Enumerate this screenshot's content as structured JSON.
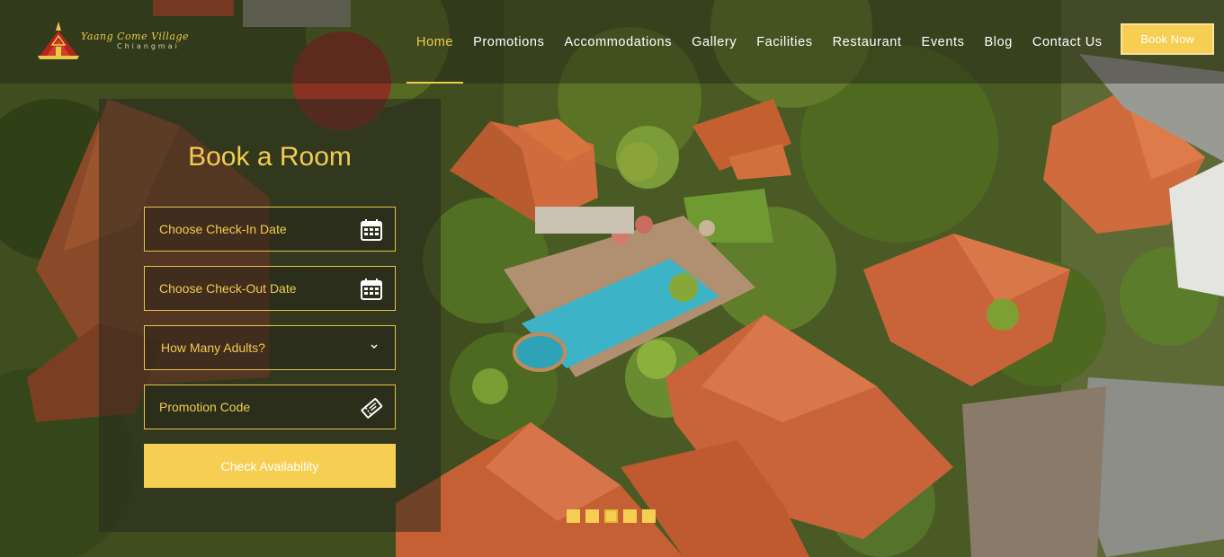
{
  "brand": {
    "name": "Yaang Come Village",
    "location": "Chiangmai"
  },
  "nav": {
    "items": [
      {
        "label": "Home",
        "active": true
      },
      {
        "label": "Promotions"
      },
      {
        "label": "Accommodations"
      },
      {
        "label": "Gallery"
      },
      {
        "label": "Facilities"
      },
      {
        "label": "Restaurant"
      },
      {
        "label": "Events"
      },
      {
        "label": "Blog"
      },
      {
        "label": "Contact Us"
      }
    ],
    "book_now": "Book Now"
  },
  "booking": {
    "title": "Book a Room",
    "checkin": {
      "value": "Choose Check-In Date",
      "icon": "calendar-icon"
    },
    "checkout": {
      "value": "Choose Check-Out Date",
      "icon": "calendar-icon"
    },
    "adults": {
      "value": "How Many Adults?",
      "icon": "chevron-down-icon"
    },
    "promo": {
      "value": "Promotion Code",
      "icon": "ticket-icon"
    },
    "submit": "Check Availability"
  },
  "slider": {
    "count": 5,
    "active_index": 2
  },
  "colors": {
    "accent": "#f6cf52",
    "accent_text": "#f3cb4f",
    "header_bg": "rgba(35,35,25,0.45)"
  }
}
